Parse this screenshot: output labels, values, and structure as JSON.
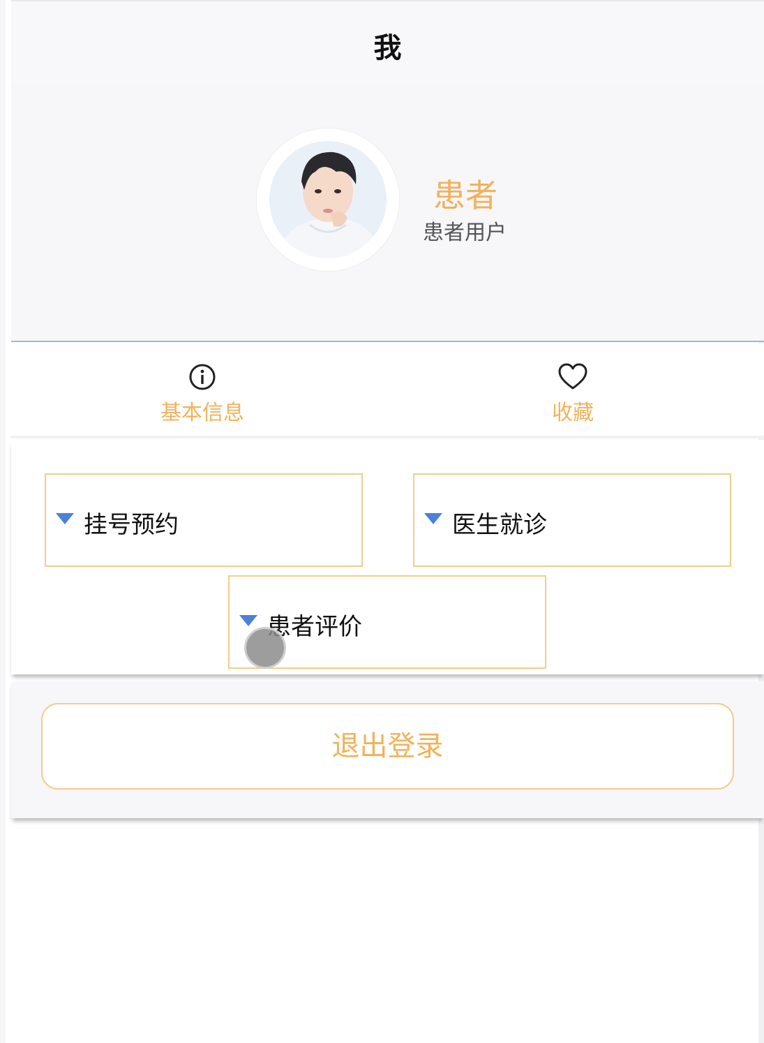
{
  "navbar": {
    "title": "我"
  },
  "profile": {
    "name": "患者",
    "role": "患者用户"
  },
  "quicklinks": [
    {
      "label": "基本信息",
      "icon": "info-circle-icon"
    },
    {
      "label": "收藏",
      "icon": "heart-icon"
    }
  ],
  "menu": [
    {
      "label": "挂号预约",
      "icon": "triangle-down-icon"
    },
    {
      "label": "医生就诊",
      "icon": "triangle-down-icon"
    },
    {
      "label": "患者评价",
      "icon": "triangle-down-icon"
    }
  ],
  "logout": {
    "label": "退出登录"
  },
  "colors": {
    "accent": "#f2b25a",
    "card_border": "#f3cc8a",
    "triangle": "#4a82d4",
    "divider": "#9db9d4"
  }
}
